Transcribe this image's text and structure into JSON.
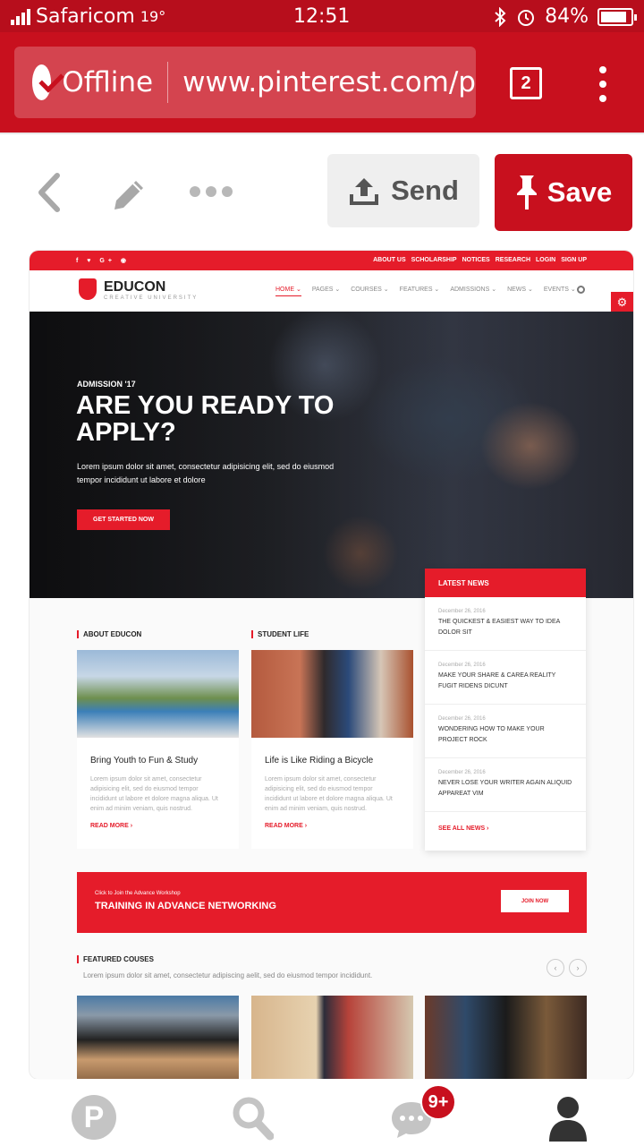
{
  "status_bar": {
    "carrier": "Safaricom",
    "temperature": "19°",
    "time": "12:51",
    "battery": "84%"
  },
  "browser": {
    "offline_label": "Offline",
    "url": "www.pinterest.com/p",
    "tab_count": "2"
  },
  "pin_actions": {
    "send_label": "Send",
    "save_label": "Save"
  },
  "pin_image": {
    "top_links": [
      "ABOUT US",
      "SCHOLARSHIP",
      "NOTICES",
      "RESEARCH",
      "LOGIN",
      "SIGN UP"
    ],
    "social": "f  ♥  G+  ◉",
    "brand": "EDUCON",
    "tagline": "CREATIVE UNIVERSITY",
    "nav": [
      "HOME ⌄",
      "PAGES ⌄",
      "COURSES ⌄",
      "FEATURES ⌄",
      "ADMISSIONS ⌄",
      "NEWS ⌄",
      "EVENTS ⌄"
    ],
    "hero": {
      "kicker": "ADMISSION '17",
      "title": "ARE YOU READY TO APPLY?",
      "lead": "Lorem ipsum dolor sit amet, consectetur adipisicing elit, sed do eiusmod tempor incididunt ut labore et dolore",
      "cta": "GET STARTED NOW"
    },
    "about_title": "ABOUT EDUCON",
    "student_title": "STUDENT LIFE",
    "cards": [
      {
        "title": "Bring Youth to Fun & Study",
        "text": "Lorem ipsum dolor sit amet, consectetur adipisicing elit, sed do eiusmod tempor incididunt ut labore et dolore magna aliqua. Ut enim ad minim veniam, quis nostrud.",
        "more": "READ MORE ›"
      },
      {
        "title": "Life is Like Riding a Bicycle",
        "text": "Lorem ipsum dolor sit amet, consectetur adipisicing elit, sed do eiusmod tempor incididunt ut labore et dolore magna aliqua. Ut enim ad minim veniam, quis nostrud.",
        "more": "READ MORE ›"
      }
    ],
    "news": {
      "heading": "LATEST NEWS",
      "items": [
        {
          "date": "December 26, 2016",
          "title": "THE QUICKEST & EASIEST WAY TO IDEA DOLOR SIT"
        },
        {
          "date": "December 26, 2016",
          "title": "MAKE YOUR SHARE & CAREA REALITY FUGIT RIDENS DICUNT"
        },
        {
          "date": "December 26, 2016",
          "title": "WONDERING HOW TO MAKE YOUR PROJECT ROCK"
        },
        {
          "date": "December 26, 2016",
          "title": "NEVER LOSE YOUR WRITER AGAIN ALIQUID APPAREAT VIM"
        }
      ],
      "see_all": "SEE ALL NEWS ›"
    },
    "banner": {
      "small": "Click to Join the Advance Workshop",
      "big": "TRAINING IN ADVANCE NETWORKING",
      "button": "JOIN NOW"
    },
    "featured": {
      "title": "FEATURED COUSES",
      "subtitle": "Lorem ipsum dolor sit amet, consectetur adipiscing aelit, sed do eiusmod tempor incididunt."
    }
  },
  "tab_bar": {
    "notification_badge": "9+"
  },
  "colors": {
    "browser_red": "#c8101e",
    "site_red": "#e51c2a"
  }
}
